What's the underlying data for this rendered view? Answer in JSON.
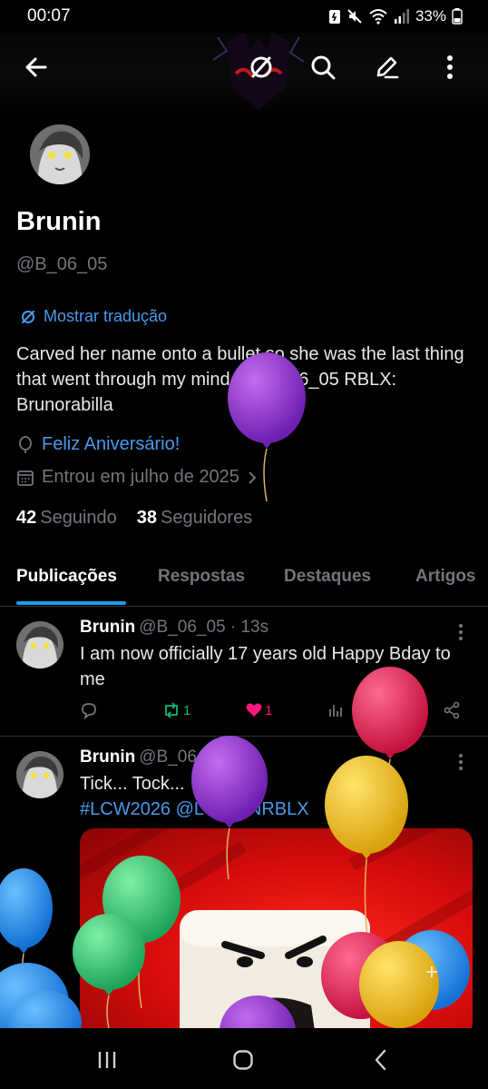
{
  "status_bar": {
    "time": "00:07",
    "battery": "33%",
    "icons": [
      "battery-saver-icon",
      "mute-icon",
      "wifi-icon",
      "signal-icon",
      "battery-icon"
    ]
  },
  "top_bar": {
    "icons": [
      "back-arrow-icon",
      "translate-icon",
      "search-icon",
      "edit-icon",
      "more-vertical-icon"
    ]
  },
  "profile": {
    "name": "Brunin",
    "handle": "@B_06_05",
    "translate_label": "Mostrar tradução",
    "bio": "Carved her name onto a bullet  so she was the last thing  that went through my mind  DC:B_06_05 RBLX: Brunorabilla",
    "birthday": "Feliz Aniversário!",
    "joined": "Entrou em julho de 2025",
    "following_count": "42",
    "following_label": "Seguindo",
    "followers_count": "38",
    "followers_label": "Seguidores"
  },
  "tabs": [
    {
      "label": "Publicações",
      "active": true
    },
    {
      "label": "Respostas",
      "active": false
    },
    {
      "label": "Destaques",
      "active": false
    },
    {
      "label": "Artigos",
      "active": false
    }
  ],
  "posts": [
    {
      "name": "Brunin",
      "meta": "@B_06_05 · 13s",
      "text": "I am now officially 17 years old Happy Bday to me",
      "retweets": "1",
      "likes": "1"
    },
    {
      "name": "Brunin",
      "meta": "@B_06_05 · 2h",
      "text_line1": "Tick... Tock...",
      "text_line2": "#LCW2026 @LCWONRBLX"
    }
  ],
  "colors": {
    "accent": "#1d9bf0",
    "link": "#4a99e9",
    "retweet": "#00ba7c",
    "like": "#f91880",
    "muted": "#71767b"
  }
}
